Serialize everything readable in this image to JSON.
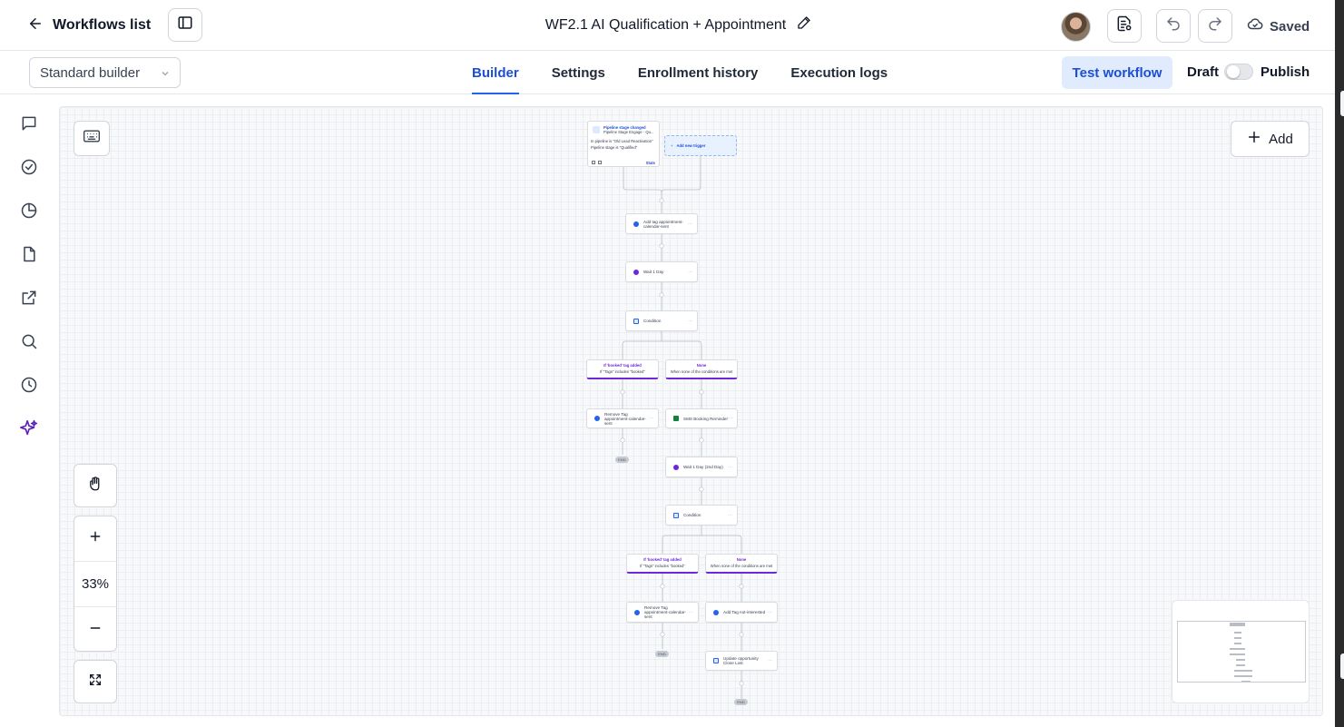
{
  "topbar": {
    "back_label": "Workflows list",
    "title": "WF2.1 AI Qualification + Appointment",
    "saved_label": "Saved"
  },
  "subbar": {
    "builder_select": "Standard builder",
    "tabs": [
      {
        "label": "Builder",
        "active": true
      },
      {
        "label": "Settings",
        "active": false
      },
      {
        "label": "Enrollment history",
        "active": false
      },
      {
        "label": "Execution logs",
        "active": false
      }
    ],
    "test_button": "Test workflow",
    "draft_label": "Draft",
    "publish_label": "Publish",
    "publish_toggle_on": false
  },
  "rail": {
    "icons": [
      "chat-icon",
      "check-circle-icon",
      "pie-chart-icon",
      "document-icon",
      "external-link-icon",
      "search-icon",
      "history-icon",
      "sparkle-icon"
    ]
  },
  "canvas": {
    "zoom": "33%",
    "add_label": "Add",
    "trigger": {
      "title": "Pipeline stage changed",
      "subtitle": "Pipeline Stage Engage - Qu...",
      "filter1": "In pipeline is \"Old Lead Reactivation\"",
      "filter2": "Pipeline stage is \"Qualified\"",
      "stats_label": "Stats",
      "add_trigger_label": "Add new trigger"
    },
    "steps": {
      "add_tag": "Add tag appointment-calendar-sent",
      "wait1": "Wait 1 Day",
      "condition1": "Condition",
      "branch1_yes_title": "If 'booked' tag added",
      "branch1_yes_desc": "If \"Tags\" includes \"booked\"",
      "branch1_none_title": "None",
      "branch1_none_desc": "When none of the conditions are met",
      "remove_tag1": "Remove Tag appointment-calendar-sent",
      "sms": "SMS Booking Reminder",
      "wait2": "Wait 1 Day (2nd Day)",
      "condition2": "Condition",
      "branch2_yes_title": "If 'booked' tag added",
      "branch2_yes_desc": "If \"Tags\" includes \"booked\"",
      "branch2_none_title": "None",
      "branch2_none_desc": "When none of the conditions are met",
      "remove_tag2": "Remove Tag appointment-calendar-sent",
      "add_not_interested": "Add Tag not-interested",
      "update_opp": "Update opportunity Close Lost",
      "end_label": "END"
    }
  },
  "colors": {
    "accent": "#2563eb",
    "branch": "#6d28d9",
    "rail_active": "#5b21b6"
  }
}
